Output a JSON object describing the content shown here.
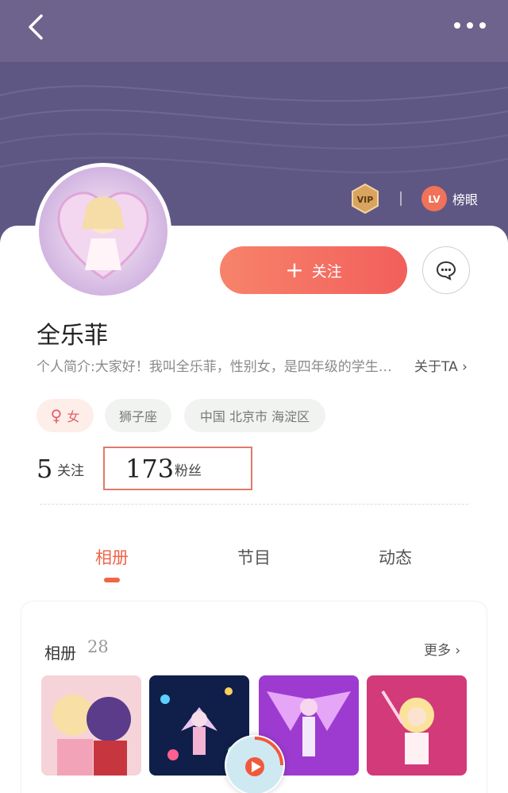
{
  "header": {
    "rank_label": "榜眼",
    "vip_text": "VIP",
    "lv_text": "LV"
  },
  "profile": {
    "name": "全乐菲",
    "bio": "个人简介:大家好！我叫全乐菲，性别女，是四年级的学生…",
    "about_label": "关于TA",
    "gender": "女",
    "zodiac": "狮子座",
    "location": "中国 北京市 海淀区"
  },
  "actions": {
    "follow_label": "关注"
  },
  "stats": {
    "following_count": "5",
    "following_label": "关注",
    "fans_count": "173",
    "fans_label": "粉丝"
  },
  "tabs": [
    {
      "label": "相册",
      "active": true
    },
    {
      "label": "节目",
      "active": false
    },
    {
      "label": "动态",
      "active": false
    }
  ],
  "album": {
    "title": "相册",
    "count": "28",
    "more_label": "更多"
  },
  "colors": {
    "accent": "#f0654a",
    "header": "#5f5783"
  }
}
